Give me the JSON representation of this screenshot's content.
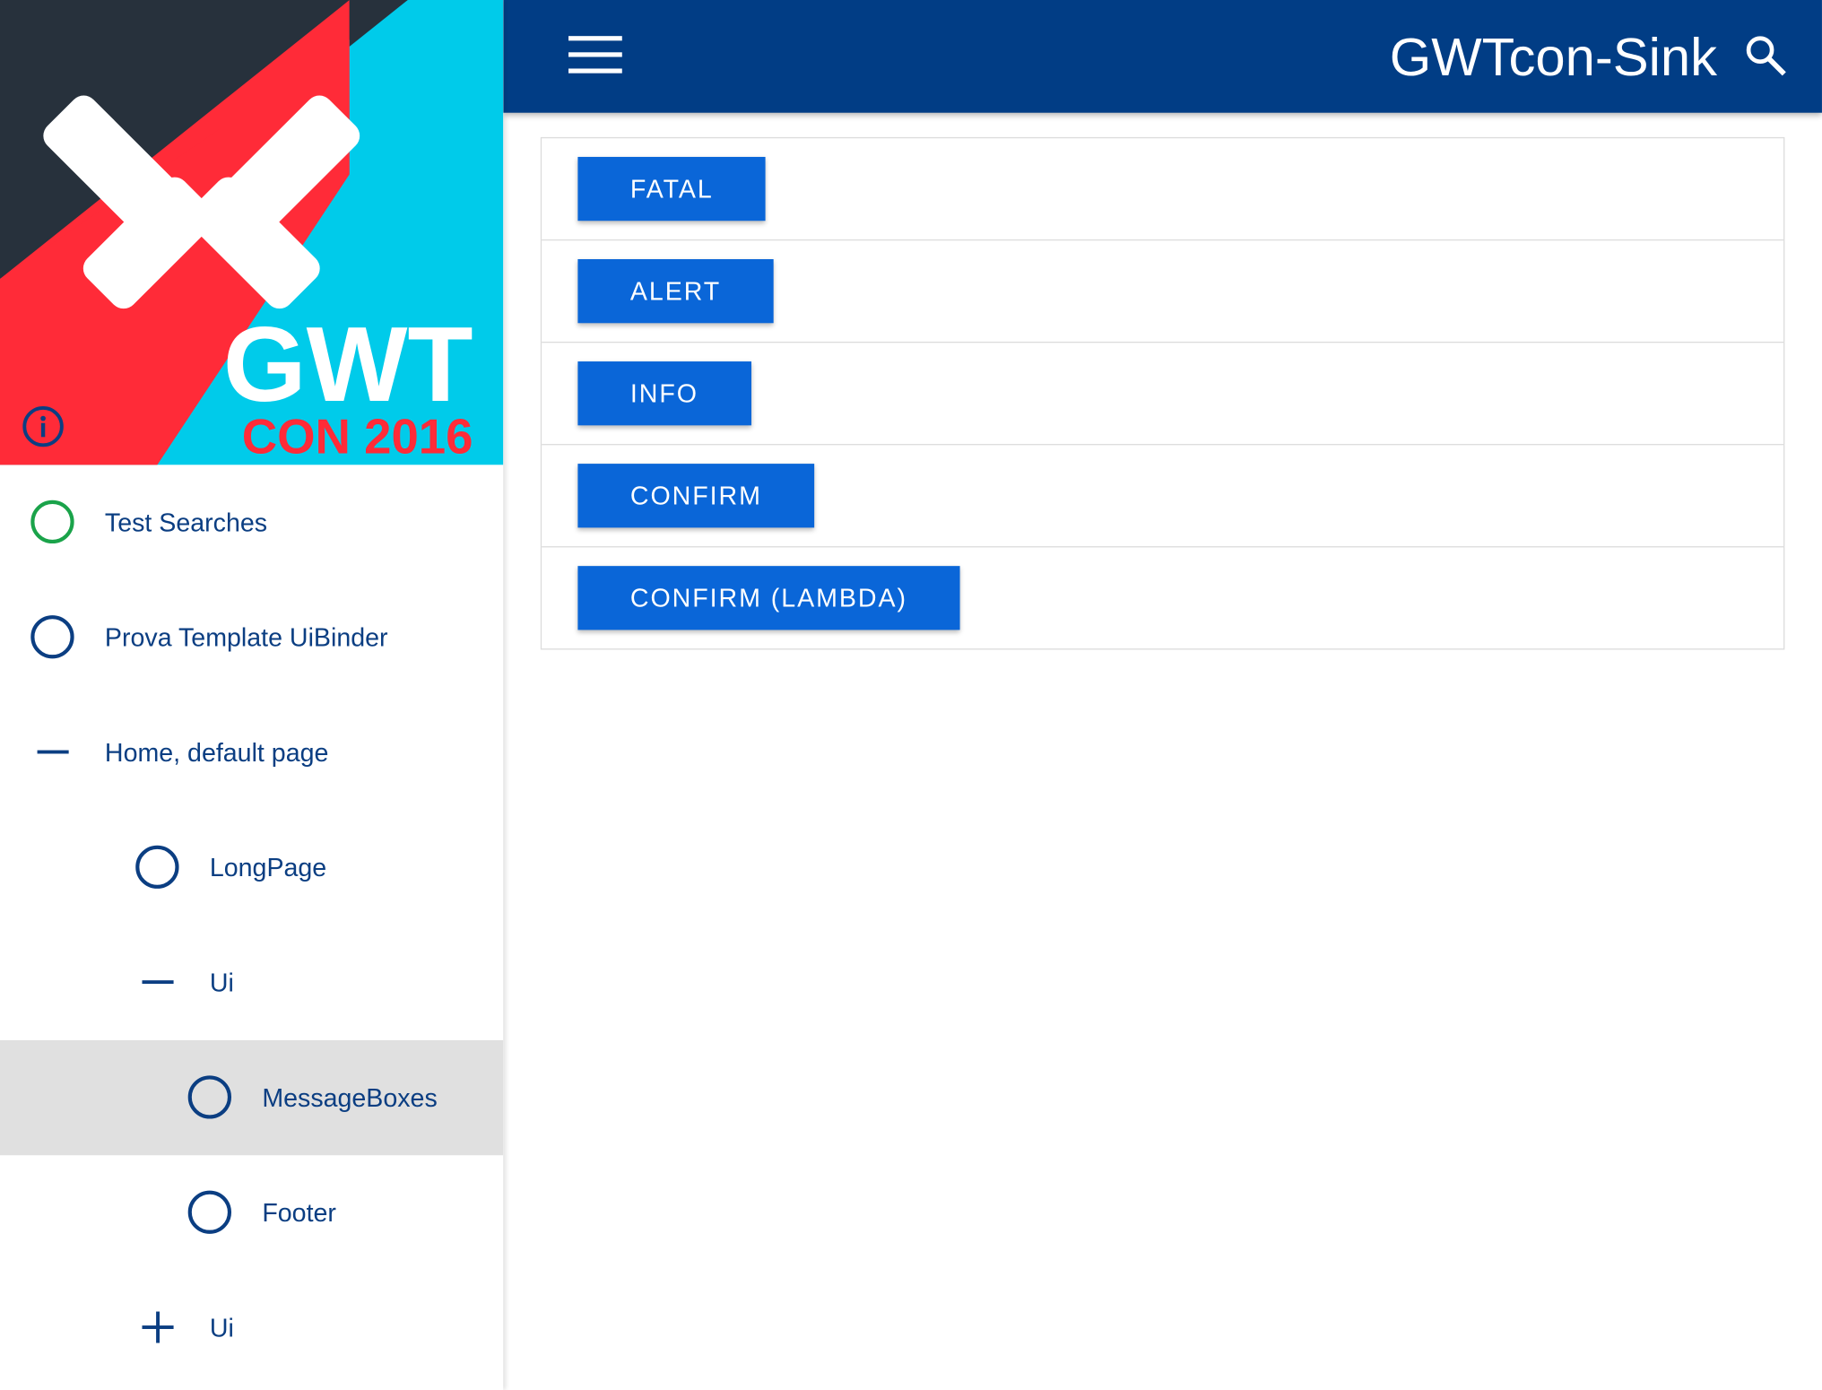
{
  "header": {
    "menu_icon": "hamburger-menu-icon",
    "title": "GWTcon-Sink",
    "search_icon": "search-icon"
  },
  "logo": {
    "text_line1": "GWT",
    "text_line2": "CON 2016",
    "colors": {
      "dark": "#27313c",
      "red": "#ff2b38",
      "cyan": "#00cbea",
      "white": "#ffffff"
    }
  },
  "sidebar": {
    "info_icon": "info-icon",
    "items": [
      {
        "label": "Test Searches",
        "icon": "circle-outline-icon",
        "level": 0,
        "icon_color": "#1aa34a"
      },
      {
        "label": "Prova Template UiBinder",
        "icon": "circle-outline-icon",
        "level": 0,
        "icon_color": "#0b3e82"
      },
      {
        "label": "Home, default page",
        "icon": "minus-icon",
        "level": 0,
        "icon_color": "#0b3e82"
      },
      {
        "label": "LongPage",
        "icon": "circle-outline-icon",
        "level": 1,
        "icon_color": "#0b3e82"
      },
      {
        "label": "Ui",
        "icon": "minus-icon",
        "level": 1,
        "icon_color": "#0b3e82"
      },
      {
        "label": "MessageBoxes",
        "icon": "circle-outline-icon",
        "level": 2,
        "icon_color": "#0b3e82",
        "selected": true
      },
      {
        "label": "Footer",
        "icon": "circle-outline-icon",
        "level": 2,
        "icon_color": "#0b3e82"
      },
      {
        "label": "Ui",
        "icon": "plus-icon",
        "level": 1,
        "icon_color": "#0b3e82"
      }
    ]
  },
  "main": {
    "buttons": [
      {
        "label": "FATAL"
      },
      {
        "label": "ALERT"
      },
      {
        "label": "INFO"
      },
      {
        "label": "CONFIRM"
      },
      {
        "label": "CONFIRM (LAMBDA)"
      }
    ]
  },
  "colors": {
    "header_bg": "#013d85",
    "button_bg": "#0a66d8",
    "nav_text": "#0b3e82",
    "selected_bg": "#e0e0e0"
  }
}
